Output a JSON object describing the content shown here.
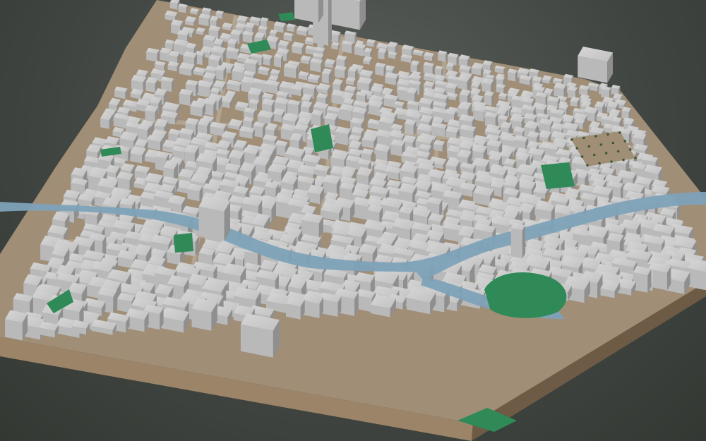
{
  "scene": {
    "type": "3d-city-block-model",
    "colors": {
      "background_light": "#5b605b",
      "background_dark": "#343934",
      "building_top": "#cfcfcf",
      "building_side_light": "#b9b9b9",
      "building_side_dark": "#8f8f8f",
      "ground": "#a08e77",
      "base_edge": "#9b8468",
      "base_edge_dark": "#6d5b46",
      "water": "#7ea2b8",
      "park": "#2f8a57",
      "plaza": "#a08e77",
      "tree": "#3d5a2c"
    },
    "features": {
      "river": true,
      "parks": 9,
      "central_plaza": true,
      "tall_tower": true
    }
  }
}
